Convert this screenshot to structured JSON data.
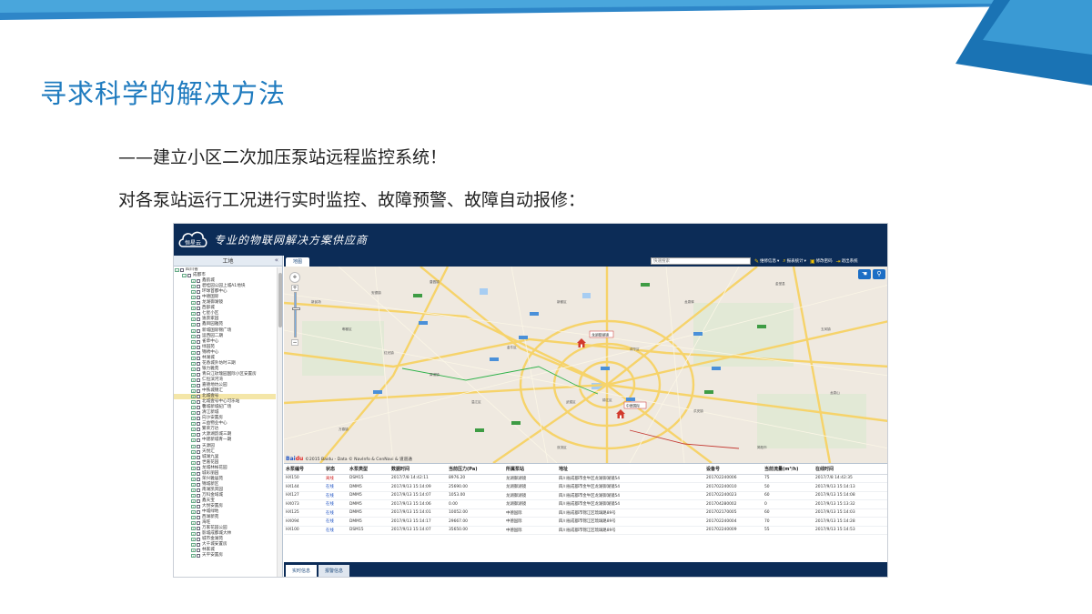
{
  "slide": {
    "title": "寻求科学的解决方法",
    "subtitle1": "——建立小区二次加压泵站远程监控系统！",
    "subtitle2": "对各泵站运行工况进行实时监控、故障预警、故障自动报修："
  },
  "colors": {
    "title": "#1f7bbf",
    "header_bg": "#0c2c57",
    "accent_blue": "#1c6ec5",
    "status_offline": "#d02020",
    "status_online": "#1a4fc2"
  },
  "app": {
    "logo_text": "恒星云",
    "slogan": "专业的物联网解决方案供应商",
    "sidebar": {
      "title": "工地",
      "collapse_icon": "«",
      "root": "四川省",
      "city": "成都市",
      "items": [
        "鑫航城",
        "碧桂园公园上城A1地块",
        "环球首都中心",
        "中德国际",
        "龙湖御湖镜",
        "西部城",
        "七星小区",
        "逸景家园",
        "鑫目园雅苑",
        "新城国际锦广场",
        "运西园二期",
        "雀草中心",
        "绿园苑",
        "锦绣中心",
        "林湖城",
        "花香城外坊时三期",
        "银力雅苑",
        "青白江玫瑰园国际小区安置房",
        "仁恒滨河湾",
        "嘉德地坑公园",
        "中铁城锦汇",
        "北城壹号",
        "北城壹号中心可乐站",
        "馨城新城纪广场",
        "清江新城",
        "向沙安置房",
        "三益物业中心",
        "繁荣万达",
        "大源湖韵城三期",
        "中建新城青一期",
        "天源园",
        "天悦汇",
        "城湖九里",
        "世嘉花园",
        "龙城林帐花园",
        "城彩丽园",
        "荣兴雅居苑",
        "锦城新区",
        "南湖凯宾园",
        "万科金域城",
        "鑫天宝",
        "大悦安置房",
        "中城绿地",
        "西湖新苑",
        "海旺",
        "万家花园公园",
        "影城成都城大林",
        "城市金湖苑",
        "大千城安置房",
        "林家城",
        "天平安置房"
      ],
      "selected_index": 21
    },
    "toolbar": {
      "map_tab": "地图",
      "search_placeholder": "快速搜索",
      "items": [
        {
          "icon": "pencil-icon",
          "label": "维修信息"
        },
        {
          "icon": "magnifier-icon",
          "label": "报表统计"
        },
        {
          "icon": "lock-icon",
          "label": "修改密码"
        },
        {
          "icon": "exit-icon",
          "label": "退出系统"
        }
      ]
    },
    "map": {
      "controls": [
        "hand-icon",
        "location-pin-icon"
      ],
      "attribution": "©2015 Baidu - Data © NavInfo & CenNavi & 道道通",
      "baidu_logo": "Bai",
      "baidu_logo_mark": "du",
      "markers": [
        "龙湖御湖镜",
        "中德国际"
      ]
    },
    "table": {
      "columns": [
        "水泵编号",
        "状态",
        "水泵类型",
        "数据时间",
        "当前压力(Pa)",
        "所属泵站",
        "地址",
        "设备号",
        "当前流量(m³/h)",
        "在线时间"
      ],
      "rows": [
        [
          "HX150",
          "离线",
          "DSM15",
          "2017/7/8 14:42:11",
          "8976.20",
          "龙湖御湖镜",
          "四川省成都市金牛区龙湖御湖镜54",
          "201702240006",
          "75",
          "2017/7/8 14:42:35"
        ],
        [
          "HX144",
          "在线",
          "DMM5",
          "2017/9/13 15:14:09",
          "25690.00",
          "龙湖御湖镜",
          "四川省成都市金牛区龙湖御湖镜54",
          "201702240010",
          "50",
          "2017/9/13 15:14:13"
        ],
        [
          "HX127",
          "在线",
          "DMM5",
          "2017/9/13 15:14:07",
          "1053.00",
          "龙湖御湖镜",
          "四川省成都市金牛区龙湖御湖镜54",
          "201702240023",
          "60",
          "2017/9/13 15:14:08"
        ],
        [
          "HX073",
          "在线",
          "DMM5",
          "2017/9/13 15:14:06",
          "0.00",
          "龙湖御湖镜",
          "四川省成都市金牛区龙湖御湖镜54",
          "201704280002",
          "0",
          "2017/9/13 15:13:32"
        ],
        [
          "HX125",
          "在线",
          "DMM5",
          "2017/9/13 15:14:01",
          "10052.00",
          "中德国际",
          "四川省成都市锦江区琉璃路89号",
          "201702170005",
          "60",
          "2017/9/13 15:14:03"
        ],
        [
          "HX094",
          "在线",
          "DMM5",
          "2017/9/13 15:14:17",
          "29667.00",
          "中德国际",
          "四川省成都市锦江区琉璃路89号",
          "201702240004",
          "70",
          "2017/9/13 15:14:28"
        ],
        [
          "HX100",
          "在线",
          "DSM15",
          "2017/9/13 15:14:07",
          "35650.00",
          "中德国际",
          "四川省成都市锦江区琉璃路89号",
          "201702240009",
          "55",
          "2017/9/13 15:14:53"
        ]
      ]
    },
    "bottom_tabs": [
      "实时信息",
      "报警信息"
    ]
  }
}
